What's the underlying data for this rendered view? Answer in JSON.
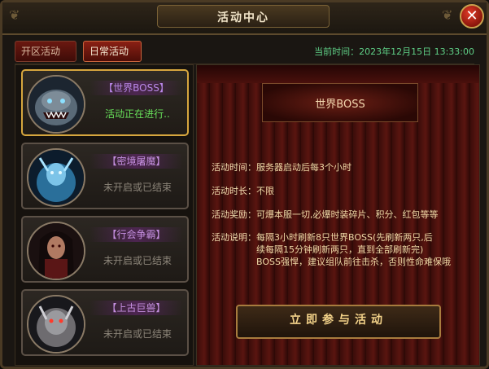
{
  "window": {
    "title": "活动中心",
    "close_label": "✕"
  },
  "tabs": [
    {
      "label": "开区活动"
    },
    {
      "label": "日常活动"
    }
  ],
  "clock": {
    "label": "当前时间：",
    "value": "2023年12月15日 13:33:00"
  },
  "events": [
    {
      "name": "【世界BOSS】",
      "status": "活动正在进行..",
      "active": true
    },
    {
      "name": "【密境屠魔】",
      "status": "未开启或已结束",
      "active": false
    },
    {
      "name": "【行会争霸】",
      "status": "未开启或已结束",
      "active": false
    },
    {
      "name": "【上古巨兽】",
      "status": "未开启或已结束",
      "active": false
    }
  ],
  "detail": {
    "banner": "世界BOSS",
    "time_label": "活动时间：",
    "time_value": "服务器启动后每3个小时",
    "duration_label": "活动时长：",
    "duration_value": "不限",
    "reward_label": "活动奖励：",
    "reward_value": "可爆本服一切,必爆时装碎片、积分、红包等等",
    "desc_label": "活动说明：",
    "desc_line1": "每隔3小时刷新8只世界BOSS(先刷新两只,后",
    "desc_line2": "续每隔15分钟刷新两只，直到全部刷新完)",
    "desc_line3": "BOSS强悍，建议组队前往击杀，否则性命难保哦",
    "join_label": "立即参与活动"
  },
  "colors": {
    "accent_gold": "#d6a63e",
    "active_green": "#68e25a",
    "name_purple": "#c58fe0",
    "time_green": "#5fcf86"
  }
}
